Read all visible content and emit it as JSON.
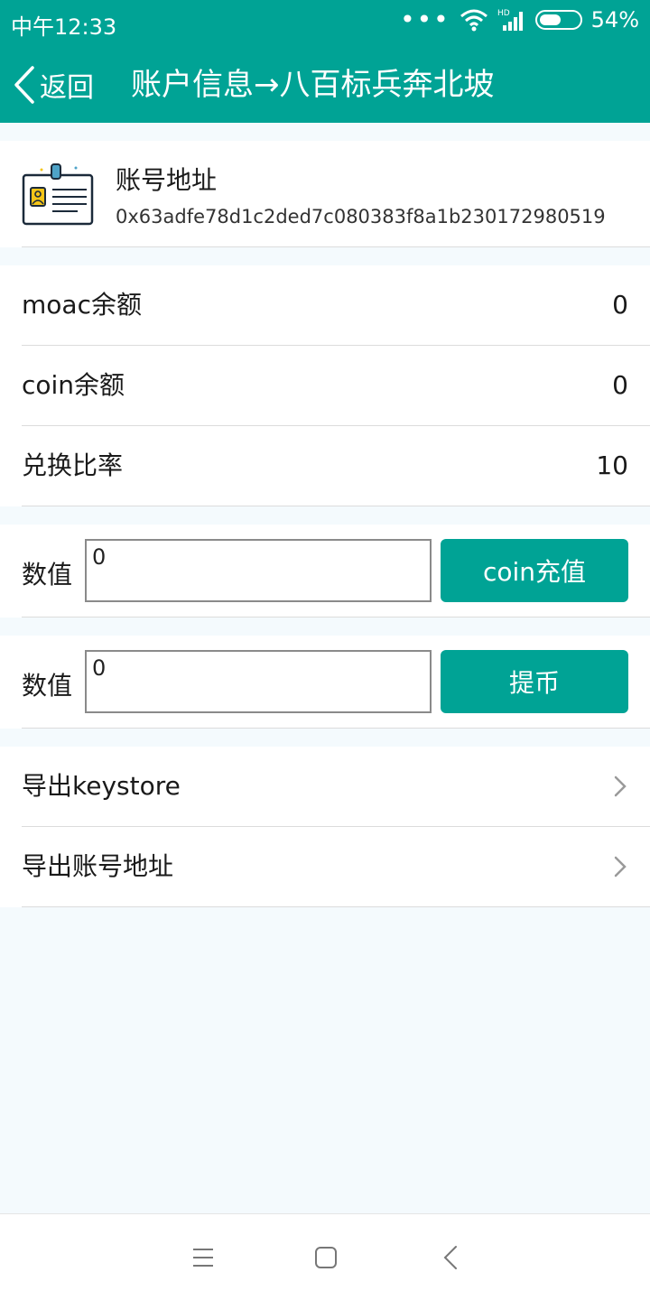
{
  "status_bar": {
    "time": "中午12:33",
    "battery_text": "54%",
    "battery_level": 0.54
  },
  "header": {
    "back_label": "返回",
    "title": "账户信息→八百标兵奔北坡"
  },
  "account": {
    "label": "账号地址",
    "address": "0x63adfe78d1c2ded7c080383f8a1b230172980519"
  },
  "balances": [
    {
      "label": "moac余额",
      "value": "0"
    },
    {
      "label": "coin余额",
      "value": "0"
    },
    {
      "label": "兑换比率",
      "value": "10"
    }
  ],
  "recharge": {
    "label": "数值",
    "input_value": "0",
    "button_label": "coin充值"
  },
  "withdraw": {
    "label": "数值",
    "input_value": "0",
    "button_label": "提币"
  },
  "export": {
    "keystore_label": "导出keystore",
    "address_label": "导出账号地址"
  },
  "colors": {
    "accent": "#00a395",
    "background": "#f4fafd"
  },
  "icons": [
    "wifi-icon",
    "signal-icon",
    "battery-icon",
    "back-chevron-icon",
    "id-card-icon",
    "chevron-right-icon",
    "menu-icon",
    "home-icon",
    "back-icon"
  ]
}
